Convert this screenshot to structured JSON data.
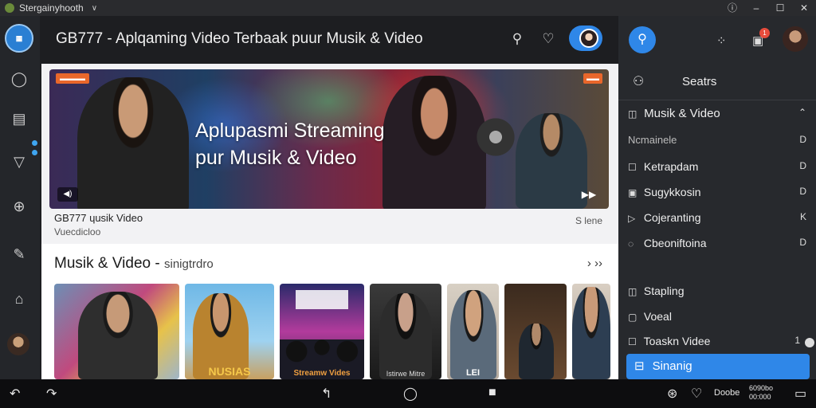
{
  "window": {
    "title": "Stergainyhooth",
    "controls": [
      "ⓘ",
      "–",
      "☐",
      "✕"
    ]
  },
  "app": {
    "title": "GB777 - Aplqaming Video Terbaak puur Musik & Video"
  },
  "hero": {
    "badge_left": "▬▬▬▬",
    "badge_right": "▬▬",
    "headline_line1": "Aplupasmi Streaming",
    "headline_line2": "pur Musik & Video",
    "caption_title": "GB777 ɥusik Video",
    "caption_sub": "Vuecdicloo",
    "caption_right": "S lene"
  },
  "section": {
    "title": "Musik & Video - ",
    "title_suffix": "sinigtrdro",
    "thumbs": [
      {
        "label": ""
      },
      {
        "label": "NUSIAS"
      },
      {
        "label": "Streamw Vides"
      },
      {
        "label": "Istirwe Mitre"
      },
      {
        "label": "LEI"
      },
      {
        "label": ""
      },
      {
        "label": ""
      }
    ]
  },
  "sidebar": {
    "search_tab": "Seatrs",
    "items": [
      {
        "label": "Musik & Video",
        "right": "⌃"
      },
      {
        "label": "Ncmainele",
        "right": "D"
      },
      {
        "label": "Ketrapdam",
        "right": "D"
      },
      {
        "label": "Sugykkosin",
        "right": "D"
      },
      {
        "label": "Cojeranting",
        "right": "K"
      },
      {
        "label": "Cbeoniftoina",
        "right": "D"
      },
      {
        "label": "Stapling",
        "right": ""
      },
      {
        "label": "Voeal",
        "right": ""
      },
      {
        "label": "Toaskn Videe",
        "right": "1"
      }
    ],
    "active_item": "Sinanig",
    "notification_count": "1"
  },
  "navbar": {
    "text1": "Doobe",
    "text2_line1": "6090bo",
    "text2_line2": "00:000"
  },
  "colors": {
    "accent": "#2f87e8",
    "badge": "#e9672b",
    "notif": "#e74c3c"
  }
}
